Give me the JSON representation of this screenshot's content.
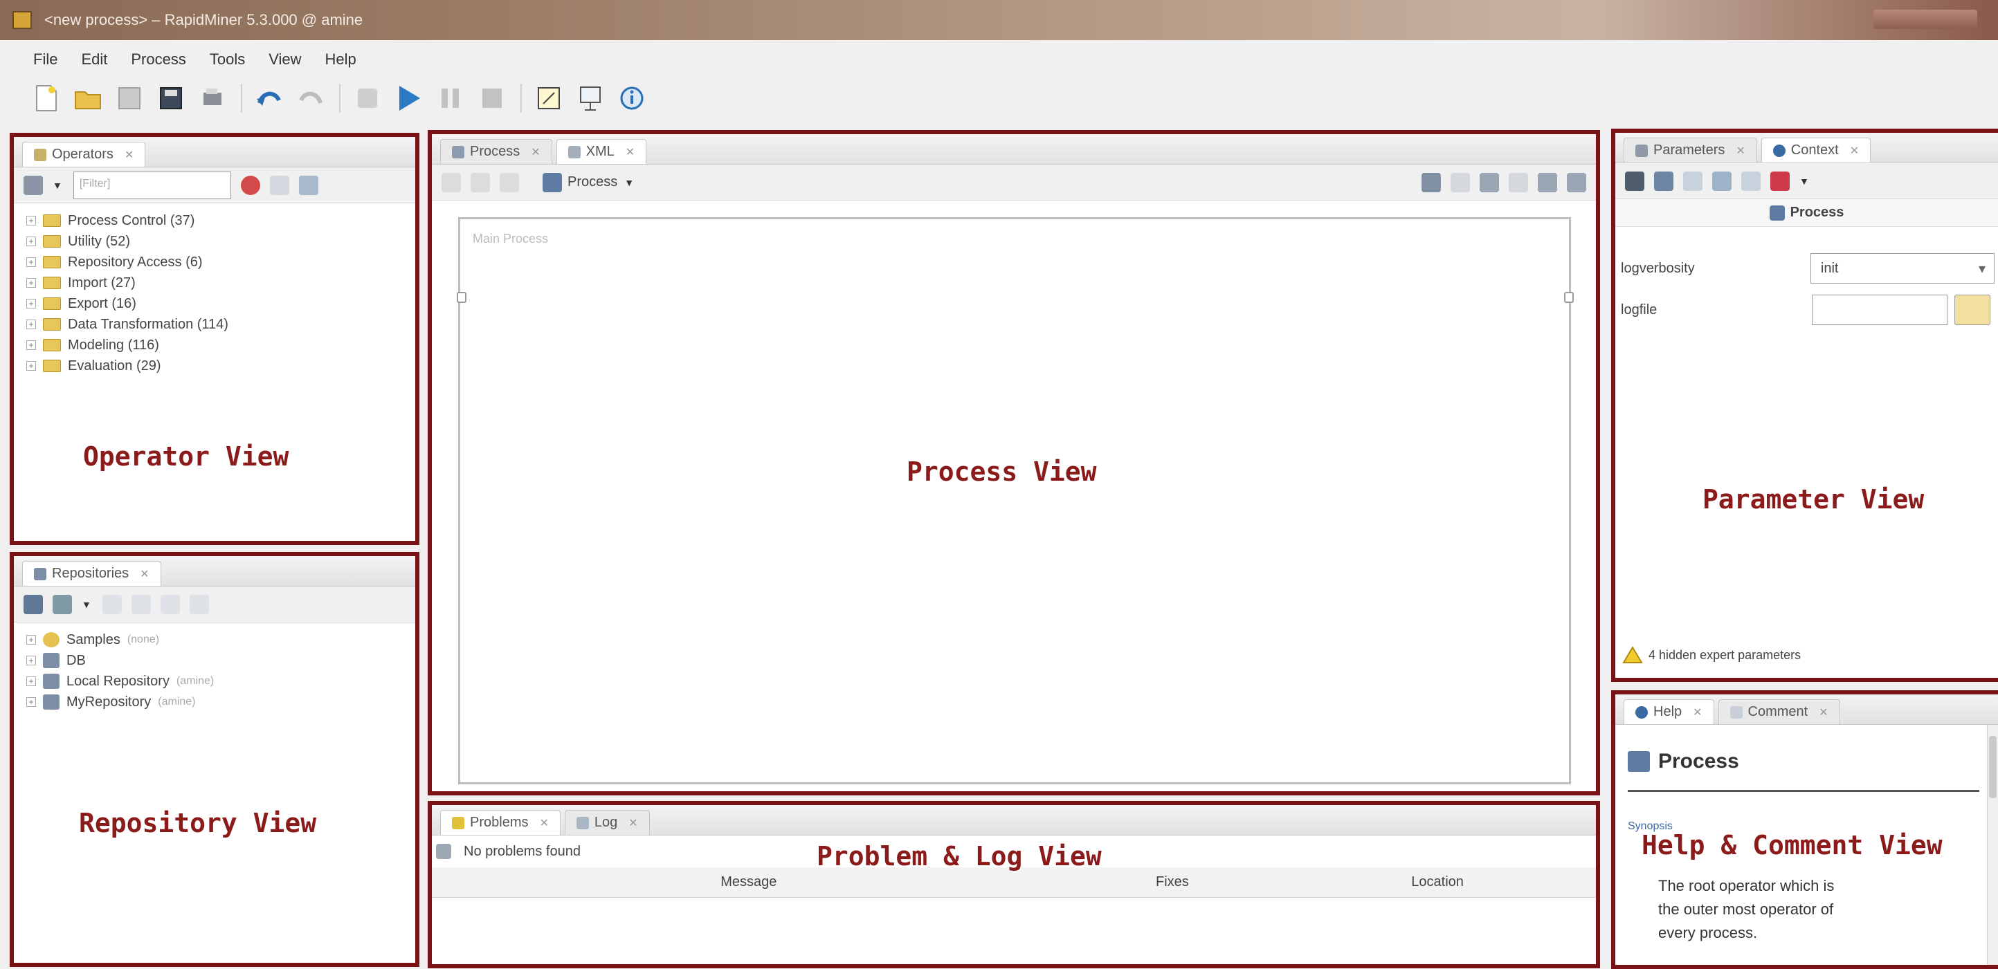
{
  "window": {
    "title": "<new process> – RapidMiner 5.3.000 @ amine"
  },
  "menu": [
    "File",
    "Edit",
    "Process",
    "Tools",
    "View",
    "Help"
  ],
  "operators_panel": {
    "tab": "Operators",
    "search_placeholder": "[Filter]",
    "tree": [
      "Process Control (37)",
      "Utility (52)",
      "Repository Access (6)",
      "Import (27)",
      "Export (16)",
      "Data Transformation (114)",
      "Modeling (116)",
      "Evaluation (29)"
    ],
    "label": "Operator View"
  },
  "repositories_panel": {
    "tab": "Repositories",
    "tree": [
      {
        "name": "Samples",
        "note": "(none)"
      },
      {
        "name": "DB",
        "note": ""
      },
      {
        "name": "Local Repository",
        "note": "(amine)"
      },
      {
        "name": "MyRepository",
        "note": "(amine)"
      }
    ],
    "label": "Repository View"
  },
  "process_panel": {
    "tabs": [
      "Process",
      "XML"
    ],
    "breadcrumb": "Process",
    "canvas_title": "Main Process",
    "label": "Process View"
  },
  "problems_panel": {
    "tabs": [
      "Problems",
      "Log"
    ],
    "status": "No problems found",
    "columns": [
      "Message",
      "Fixes",
      "Location"
    ],
    "label": "Problem & Log View"
  },
  "parameters_panel": {
    "tabs": [
      "Parameters",
      "Context"
    ],
    "operator": "Process",
    "params": [
      {
        "name": "logverbosity",
        "value": "init"
      },
      {
        "name": "logfile",
        "value": ""
      }
    ],
    "hidden_note": "4 hidden expert parameters",
    "label": "Parameter View"
  },
  "help_panel": {
    "tabs": [
      "Help",
      "Comment"
    ],
    "title": "Process",
    "synopsis_label": "Synopsis",
    "description": [
      "The root operator which is",
      "the outer most operator of",
      "every process."
    ],
    "label": "Help & Comment View"
  },
  "colors": {
    "frame_border": "#7b1218",
    "view_label": "#8b1a1a",
    "run_button": "#2b7bc4"
  }
}
